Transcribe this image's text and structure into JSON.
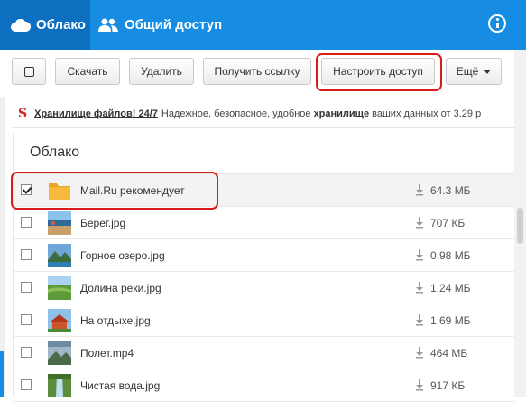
{
  "header": {
    "tabs": [
      {
        "label": "Облако",
        "icon": "cloud-icon",
        "active": true
      },
      {
        "label": "Общий доступ",
        "icon": "users-icon",
        "active": false
      }
    ],
    "menu_icon": "more-vertical-icon"
  },
  "toolbar": {
    "download_label": "Скачать",
    "delete_label": "Удалить",
    "get_link_label": "Получить ссылку",
    "configure_access_label": "Настроить доступ",
    "more_label": "Ещё"
  },
  "ad": {
    "logo": "S",
    "link": "Хранилище файлов! 24/7",
    "text_1": "Надежное, безопасное, удобное",
    "text_bold": "хранилище",
    "text_2": "ваших данных от 3.29 р"
  },
  "panel": {
    "title": "Облако",
    "files": [
      {
        "name": "Mail.Ru рекомендует",
        "size": "64.3 МБ",
        "type": "folder",
        "checked": true
      },
      {
        "name": "Берег.jpg",
        "size": "707 КБ",
        "type": "image",
        "checked": false
      },
      {
        "name": "Горное озеро.jpg",
        "size": "0.98 МБ",
        "type": "image",
        "checked": false
      },
      {
        "name": "Долина реки.jpg",
        "size": "1.24 МБ",
        "type": "image",
        "checked": false
      },
      {
        "name": "На отдыхе.jpg",
        "size": "1.69 МБ",
        "type": "image",
        "checked": false
      },
      {
        "name": "Полет.mp4",
        "size": "464 МБ",
        "type": "video",
        "checked": false
      },
      {
        "name": "Чистая вода.jpg",
        "size": "917 КБ",
        "type": "image",
        "checked": false
      }
    ]
  },
  "colors": {
    "header_bg": "#168de2",
    "active_tab_bg": "#0c6fc0",
    "highlight_ring": "#d81c1c",
    "folder": "#f6b93b"
  }
}
